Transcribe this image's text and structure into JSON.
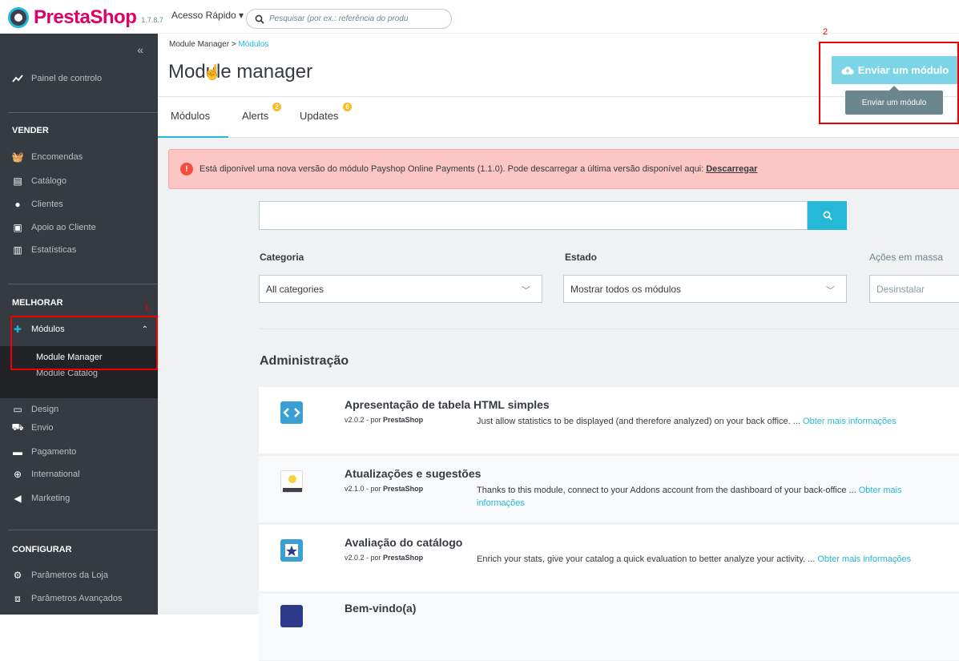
{
  "topbar": {
    "logo_text": "PrestaShop",
    "version": "1.7.8.7",
    "quick_access": "Acesso Rápido ▾",
    "search_placeholder": "Pesquisar (por ex.: referência do produ"
  },
  "sidebar": {
    "collapse": "«",
    "dashboard": "Painel de controlo",
    "sections": {
      "sell": "VENDER",
      "improve": "MELHORAR",
      "configure": "CONFIGURAR"
    },
    "sell_items": [
      "Encomendas",
      "Catálogo",
      "Clientes",
      "Apoio ao Cliente",
      "Estatísticas"
    ],
    "modules": "Módulos",
    "module_sub": [
      "Module Manager",
      "Module Catalog"
    ],
    "improve_items": [
      "Design",
      "Envio",
      "Pagamento",
      "International",
      "Marketing"
    ],
    "configure_items": [
      "Parâmetros da Loja",
      "Parâmetros Avançados"
    ],
    "annotation_1": "1"
  },
  "header": {
    "breadcrumb_parent": "Module Manager",
    "breadcrumb_sep": ">",
    "breadcrumb_current": "Módulos",
    "title": "Module manager",
    "tabs": [
      "Módulos",
      "Alerts",
      "Updates"
    ],
    "alerts_count": "2",
    "updates_count": "6",
    "upload_button": "Enviar um módulo",
    "tooltip": "Enviar um módulo",
    "annotation_2": "2"
  },
  "content": {
    "alert_text": "Está diponível uma nova versão do módulo Payshop Online Payments (1.1.0). Pode descarregar a última versão disponível aqui:",
    "alert_link": "Descarregar",
    "filter_category_label": "Categoria",
    "filter_category_value": "All categories",
    "filter_status_label": "Estado",
    "filter_status_value": "Mostrar todos os módulos",
    "bulk_label": "Ações em massa",
    "bulk_value": "Desinstalar",
    "section_title": "Administração",
    "modules": [
      {
        "name": "Apresentação de tabela HTML simples",
        "version": "v2.0.2 - por",
        "author": "PrestaShop",
        "desc": "Just allow statistics to be displayed (and therefore analyzed) on your back office. ...",
        "more": "Obter mais informações"
      },
      {
        "name": "Atualizações e sugestões",
        "version": "v2.1.0 - por",
        "author": "PrestaShop",
        "desc": "Thanks to this module, connect to your Addons account from the dashboard of your back-office ...",
        "more": "Obter mais informações"
      },
      {
        "name": "Avaliação do catálogo",
        "version": "v2.0.2 - por",
        "author": "PrestaShop",
        "desc": "Enrich your stats, give your catalog a quick evaluation to better analyze your activity. ...",
        "more": "Obter mais informações"
      },
      {
        "name": "Bem-vindo(a)"
      }
    ]
  }
}
